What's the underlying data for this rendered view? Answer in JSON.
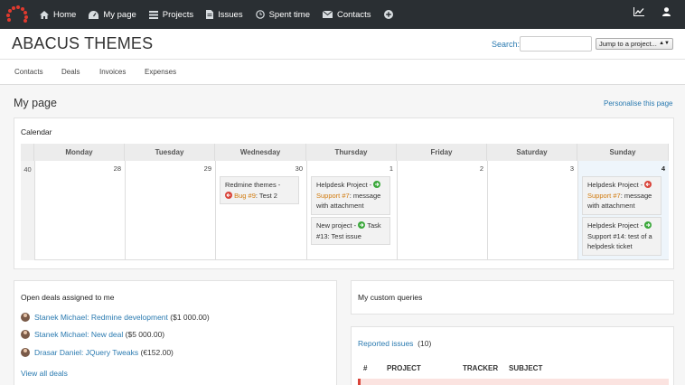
{
  "nav": {
    "items": [
      {
        "label": "Home",
        "icon": "home-icon"
      },
      {
        "label": "My page",
        "icon": "dashboard-icon"
      },
      {
        "label": "Projects",
        "icon": "list-icon"
      },
      {
        "label": "Issues",
        "icon": "document-icon"
      },
      {
        "label": "Spent time",
        "icon": "clock-icon"
      },
      {
        "label": "Contacts",
        "icon": "envelope-icon"
      }
    ],
    "add_icon": "plus-circle-icon",
    "right_icons": [
      "activity-chart-icon",
      "user-icon"
    ]
  },
  "header": {
    "project_title": "ABACUS THEMES",
    "search_label": "Search:",
    "search_value": "",
    "jump_label": "Jump to a project..."
  },
  "tabs": [
    "Contacts",
    "Deals",
    "Invoices",
    "Expenses"
  ],
  "main": {
    "page_title": "My page",
    "personalise_link": "Personalise this page"
  },
  "calendar": {
    "title": "Calendar",
    "days": [
      "Monday",
      "Tuesday",
      "Wednesday",
      "Thursday",
      "Friday",
      "Saturday",
      "Sunday"
    ],
    "week_number": "40",
    "dates": [
      "28",
      "29",
      "30",
      "1",
      "2",
      "3",
      "4"
    ],
    "events": {
      "wed": {
        "project": "Redmine themes -",
        "tracker": "Bug #9",
        "subject": ": Test 2"
      },
      "thu1": {
        "project": "Helpdesk Project -",
        "tracker": "Support #7",
        "subject": ": message with attachment"
      },
      "thu2": {
        "project": "New project -",
        "tracker": "Task #13",
        "subject": ": Test issue"
      },
      "sun1": {
        "project": "Helpdesk Project -",
        "tracker": "Support #7",
        "subject": ": message with attachment"
      },
      "sun2": {
        "project": "Helpdesk Project -",
        "tracker": "Support #14",
        "subject": ": test of a helpdesk ticket"
      }
    }
  },
  "deals": {
    "title": "Open deals assigned to me",
    "items": [
      {
        "name": "Stanek Michael: Redmine development",
        "amount": "($1 000.00)"
      },
      {
        "name": "Stanek Michael: New deal",
        "amount": "($5 000.00)"
      },
      {
        "name": "Drasar Daniel: JQuery Tweaks",
        "amount": "(€152.00)"
      }
    ],
    "view_all": "View all deals"
  },
  "queries": {
    "title": "My custom queries"
  },
  "reported": {
    "title": "Reported issues",
    "count": "(10)",
    "columns": [
      "#",
      "PROJECT",
      "TRACKER",
      "SUBJECT"
    ]
  },
  "colors": {
    "topbar": "#2a2f33",
    "link": "#2a7ab0",
    "tracker_orange": "#d17b0f",
    "green_arrow": "#3ba83b",
    "red_arrow": "#d9443a"
  }
}
